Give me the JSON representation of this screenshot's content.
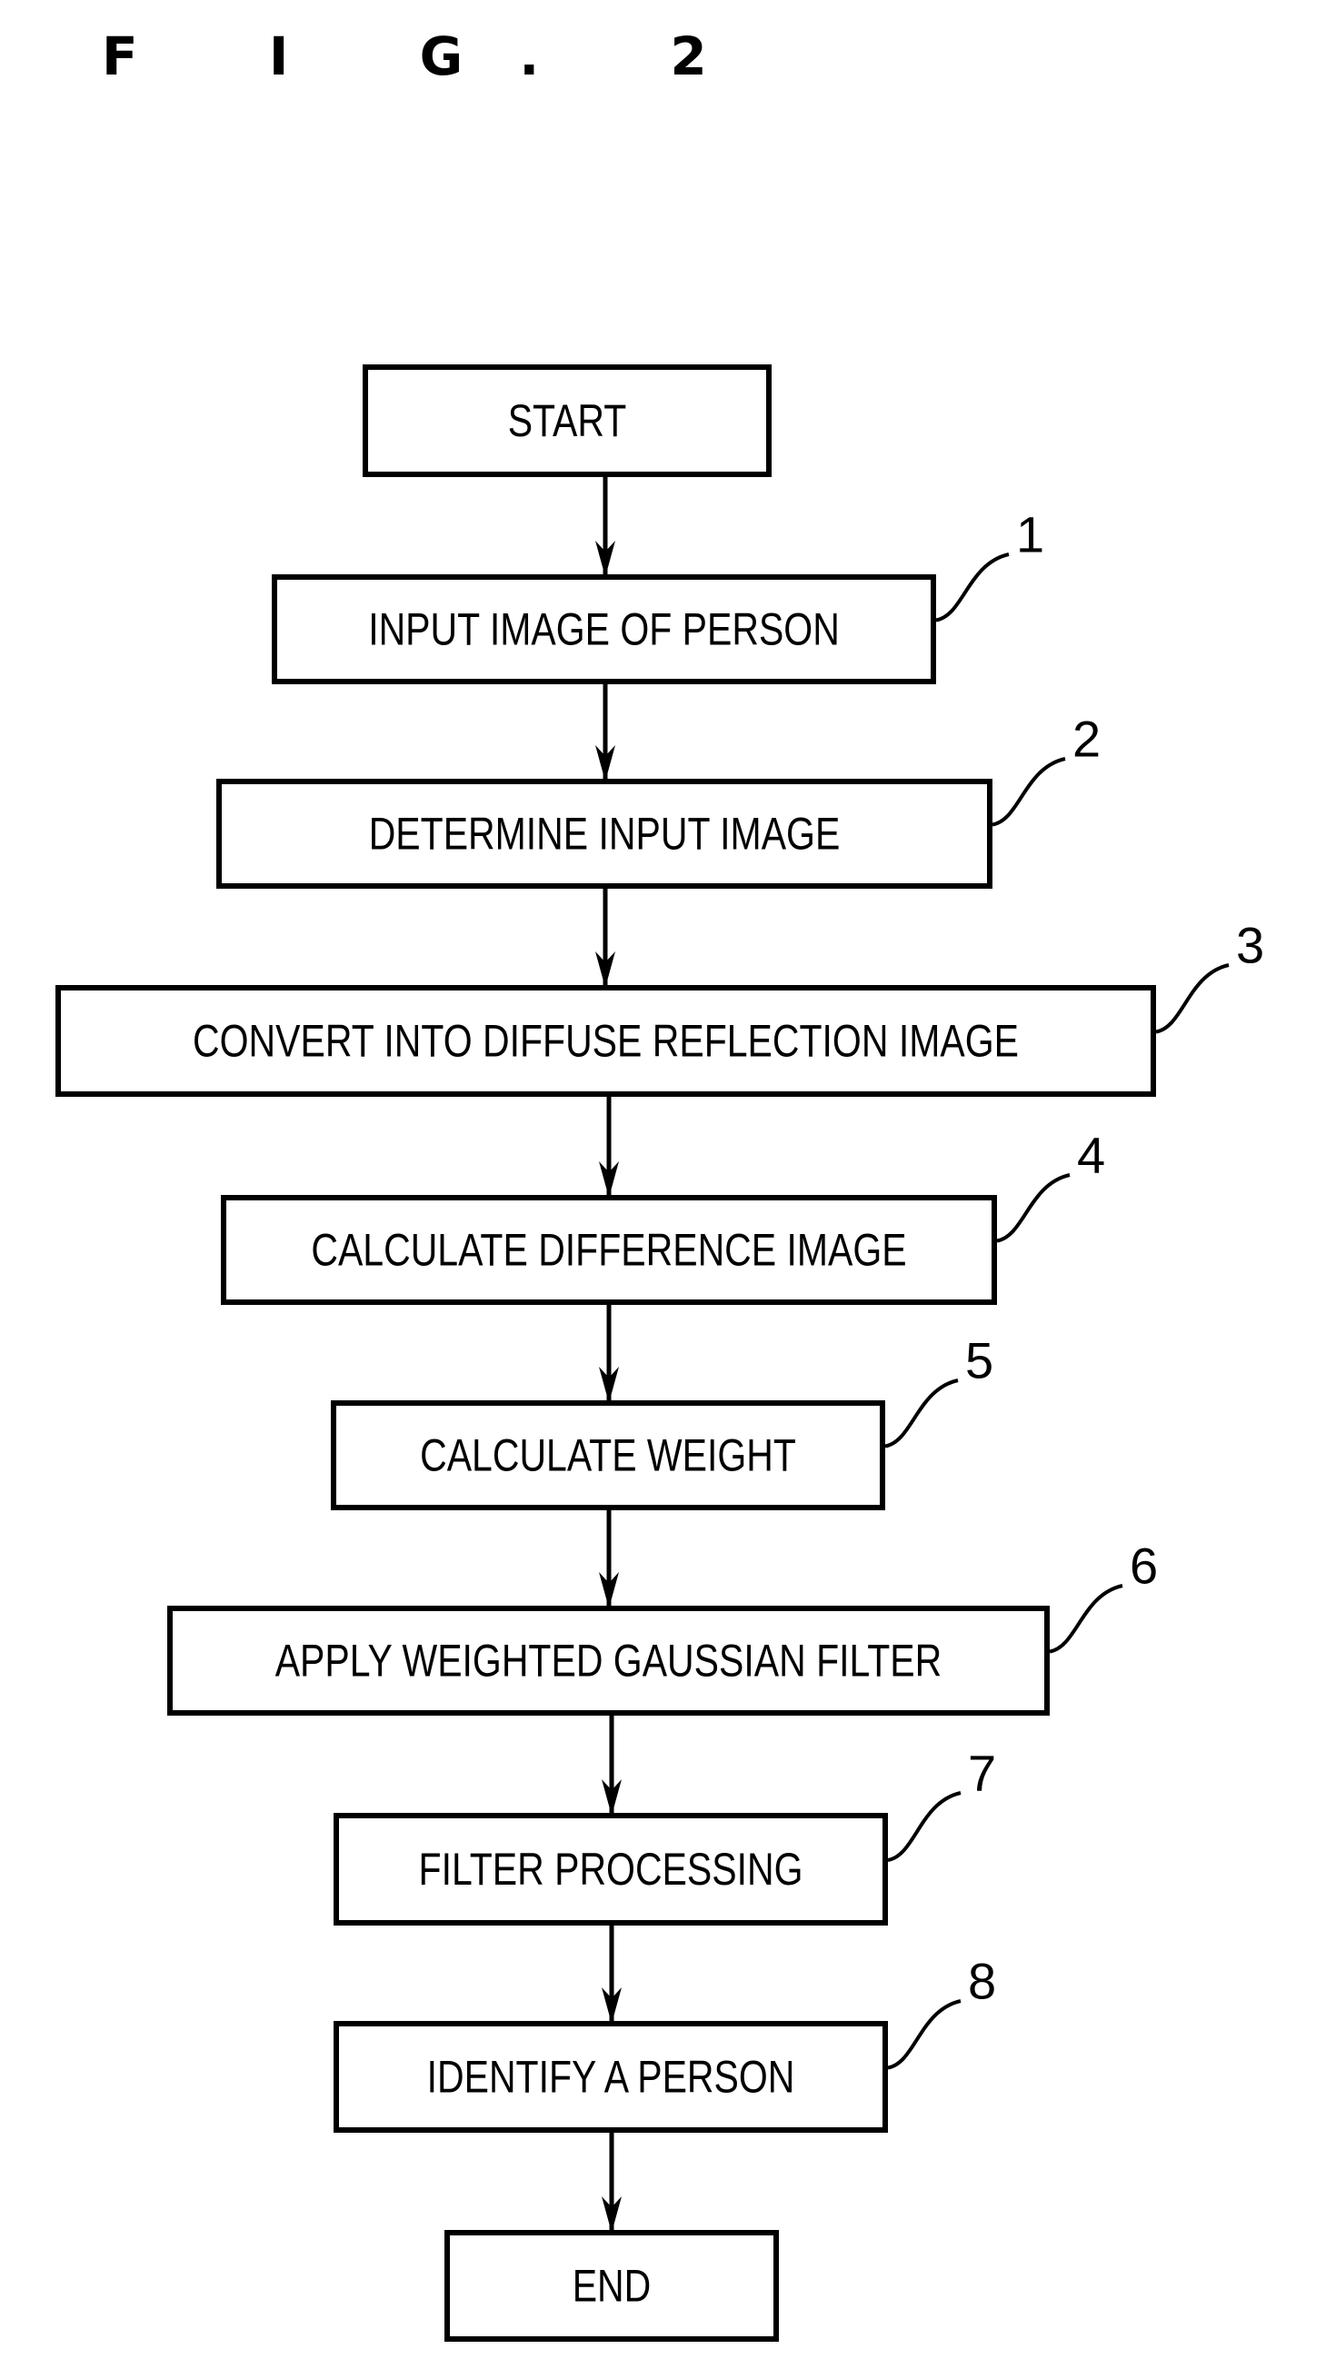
{
  "figure": {
    "title": "F I G. 2"
  },
  "flowchart": {
    "nodes": [
      {
        "id": "start",
        "label": "START",
        "ref": ""
      },
      {
        "id": "step1",
        "label": "INPUT IMAGE OF PERSON",
        "ref": "1"
      },
      {
        "id": "step2",
        "label": "DETERMINE INPUT IMAGE",
        "ref": "2"
      },
      {
        "id": "step3",
        "label": "CONVERT INTO DIFFUSE REFLECTION IMAGE",
        "ref": "3"
      },
      {
        "id": "step4",
        "label": "CALCULATE DIFFERENCE IMAGE",
        "ref": "4"
      },
      {
        "id": "step5",
        "label": "CALCULATE WEIGHT",
        "ref": "5"
      },
      {
        "id": "step6",
        "label": "APPLY WEIGHTED GAUSSIAN FILTER",
        "ref": "6"
      },
      {
        "id": "step7",
        "label": "FILTER PROCESSING",
        "ref": "7"
      },
      {
        "id": "step8",
        "label": "IDENTIFY A PERSON",
        "ref": "8"
      },
      {
        "id": "end",
        "label": "END",
        "ref": ""
      }
    ],
    "edges": [
      [
        "start",
        "step1"
      ],
      [
        "step1",
        "step2"
      ],
      [
        "step2",
        "step3"
      ],
      [
        "step3",
        "step4"
      ],
      [
        "step4",
        "step5"
      ],
      [
        "step5",
        "step6"
      ],
      [
        "step6",
        "step7"
      ],
      [
        "step7",
        "step8"
      ],
      [
        "step8",
        "end"
      ]
    ]
  }
}
